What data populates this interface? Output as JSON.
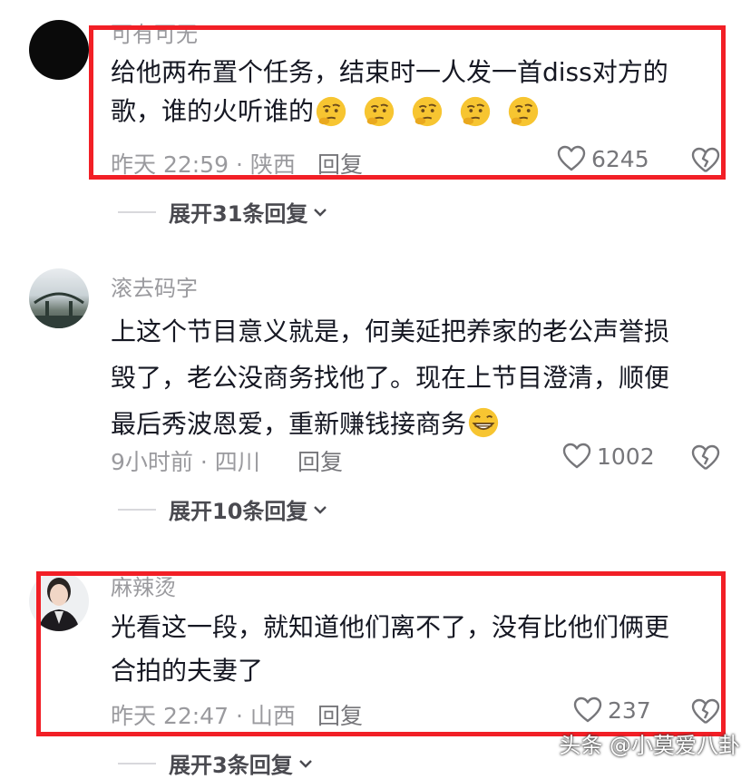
{
  "comments": [
    {
      "username": "可有可无",
      "lines": [
        "给他两布置个任务，结束时一人发一首diss对方的",
        "歌，谁的火听谁的"
      ],
      "emoji": "thinking-face-emoji",
      "meta": "昨天 22:59 · 陕西",
      "reply_label": "回复",
      "likes": "6245",
      "expand_label": "展开31条回复"
    },
    {
      "username": "滚去码字",
      "lines": [
        "上这个节目意义就是，何美延把养家的老公声誉损",
        "毁了，老公没商务找他了。现在上节目澄清，顺便",
        "最后秀波恩爱，重新赚钱接商务"
      ],
      "emoji": "grinning-face-emoji",
      "meta": "9小时前 · 四川",
      "reply_label": "回复",
      "likes": "1002",
      "expand_label": "展开10条回复"
    },
    {
      "username": "麻辣烫",
      "lines": [
        "光看这一段，就知道他们离不了，没有比他们俩更",
        "合拍的夫妻了"
      ],
      "meta": "昨天 22:47 · 山西",
      "reply_label": "回复",
      "likes": "237",
      "expand_label": "展开3条回复"
    }
  ],
  "watermark": "头条 @小莫爱八卦",
  "colors": {
    "highlight": "#f21f26",
    "text": "#161823",
    "muted": "#9a9a9e"
  }
}
